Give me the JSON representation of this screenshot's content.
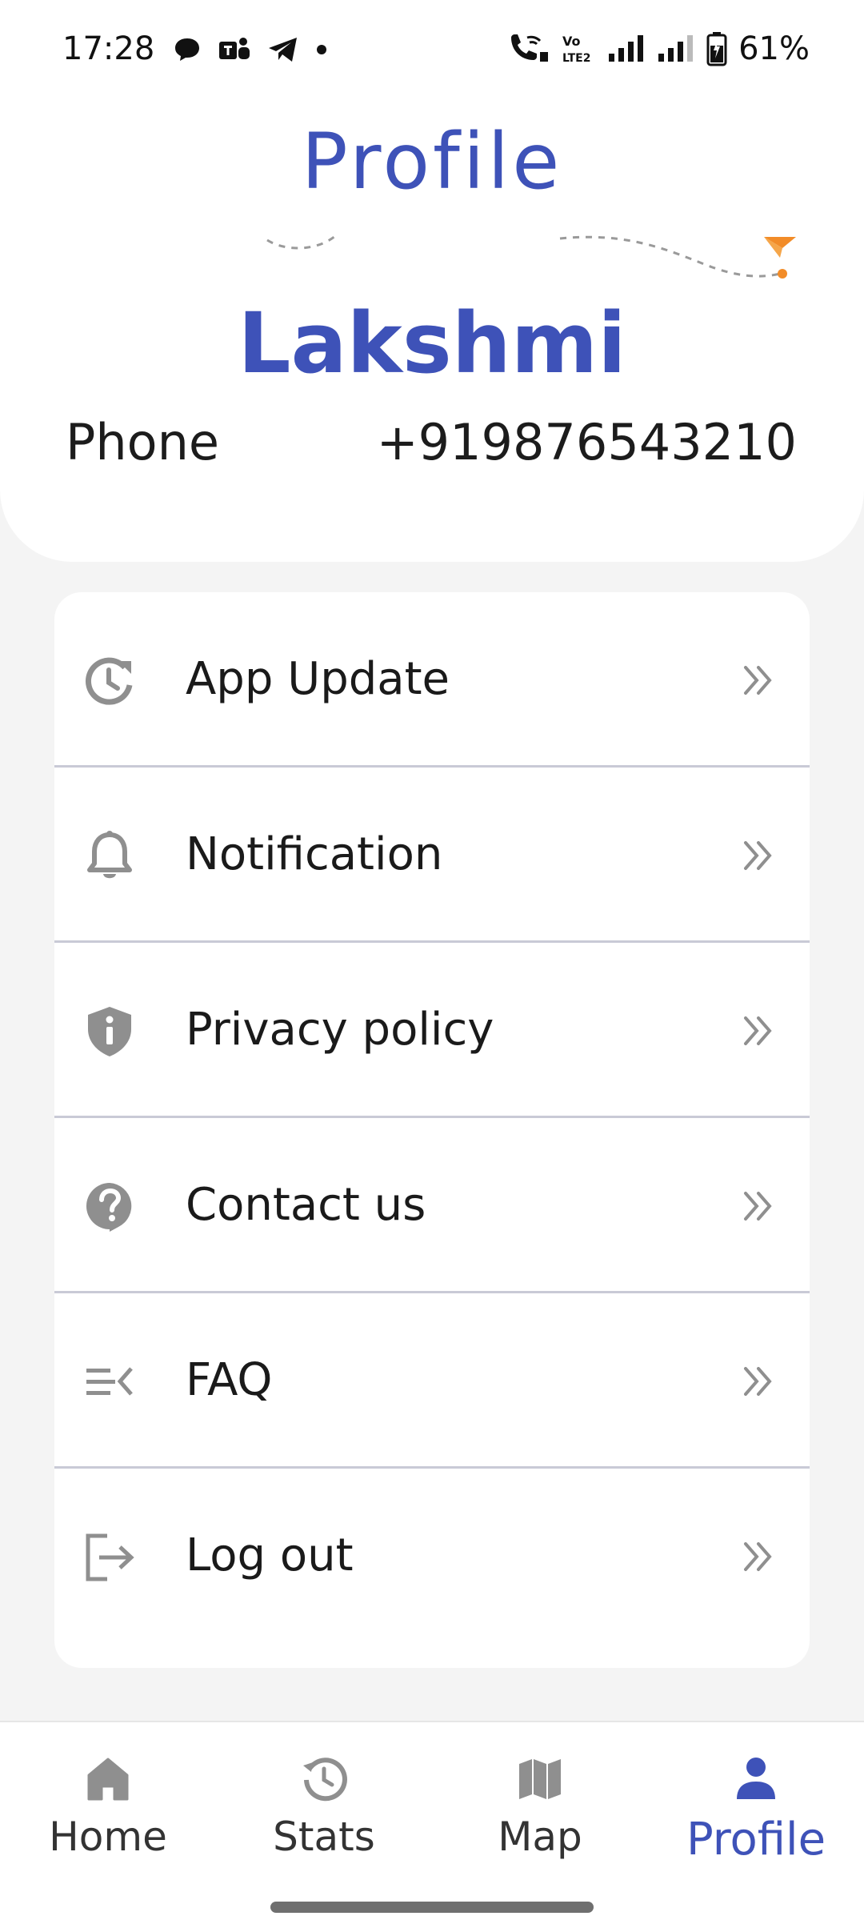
{
  "status_bar": {
    "time": "17:28",
    "battery": "61%",
    "left_icons": [
      "chat-bubble-icon",
      "teams-icon",
      "telegram-icon",
      "dot-icon"
    ],
    "right_icons": [
      "wifi-calling-icon",
      "volte-icon",
      "signal-icon",
      "signal-icon",
      "battery-icon"
    ]
  },
  "header": {
    "title": "Profile",
    "user_name": "Lakshmi",
    "phone_label": "Phone",
    "phone_value": "+919876543210",
    "accent_color": "#3e52b8",
    "decoration_color": "#f28c28"
  },
  "menu": {
    "items": [
      {
        "label": "App Update",
        "icon": "update-clock-icon"
      },
      {
        "label": "Notification",
        "icon": "bell-icon"
      },
      {
        "label": "Privacy policy",
        "icon": "shield-info-icon"
      },
      {
        "label": "Contact us",
        "icon": "help-circle-icon"
      },
      {
        "label": "FAQ",
        "icon": "faq-list-icon"
      },
      {
        "label": "Log out",
        "icon": "logout-icon"
      }
    ],
    "chevron_icon": "double-chevron-right-icon"
  },
  "bottom_nav": {
    "items": [
      {
        "label": "Home",
        "icon": "home-icon",
        "active": false
      },
      {
        "label": "Stats",
        "icon": "history-icon",
        "active": false
      },
      {
        "label": "Map",
        "icon": "map-icon",
        "active": false
      },
      {
        "label": "Profile",
        "icon": "person-icon",
        "active": true
      }
    ]
  }
}
